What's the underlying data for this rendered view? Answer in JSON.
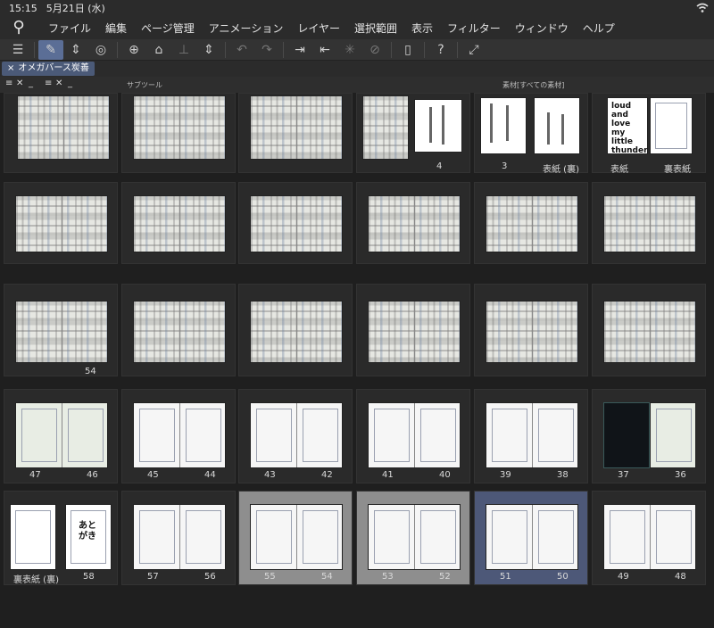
{
  "status": {
    "time": "15:15",
    "date": "5月21日 (水)"
  },
  "menu": [
    "ファイル",
    "編集",
    "ページ管理",
    "アニメーション",
    "レイヤー",
    "選択範囲",
    "表示",
    "フィルター",
    "ウィンドウ",
    "ヘルプ"
  ],
  "tab": {
    "close": "×",
    "title": "オメガバース炭善"
  },
  "panel": {
    "subtool_label": "サブツール",
    "material_label": "素材[すべての素材]"
  },
  "pages": {
    "row1": [
      "4",
      "3",
      "表紙 (裏)",
      "表紙",
      "裏表紙"
    ],
    "cover_text": "loud and love my little thunder",
    "row3": [
      "54"
    ],
    "row4": [
      "47",
      "46",
      "45",
      "44",
      "43",
      "42",
      "41",
      "40",
      "39",
      "38",
      "37",
      "36"
    ],
    "row5": [
      "裏表紙 (裏)",
      "58",
      "57",
      "56",
      "55",
      "54",
      "53",
      "52",
      "51",
      "50",
      "49",
      "48"
    ],
    "afterword": "あとがき"
  }
}
